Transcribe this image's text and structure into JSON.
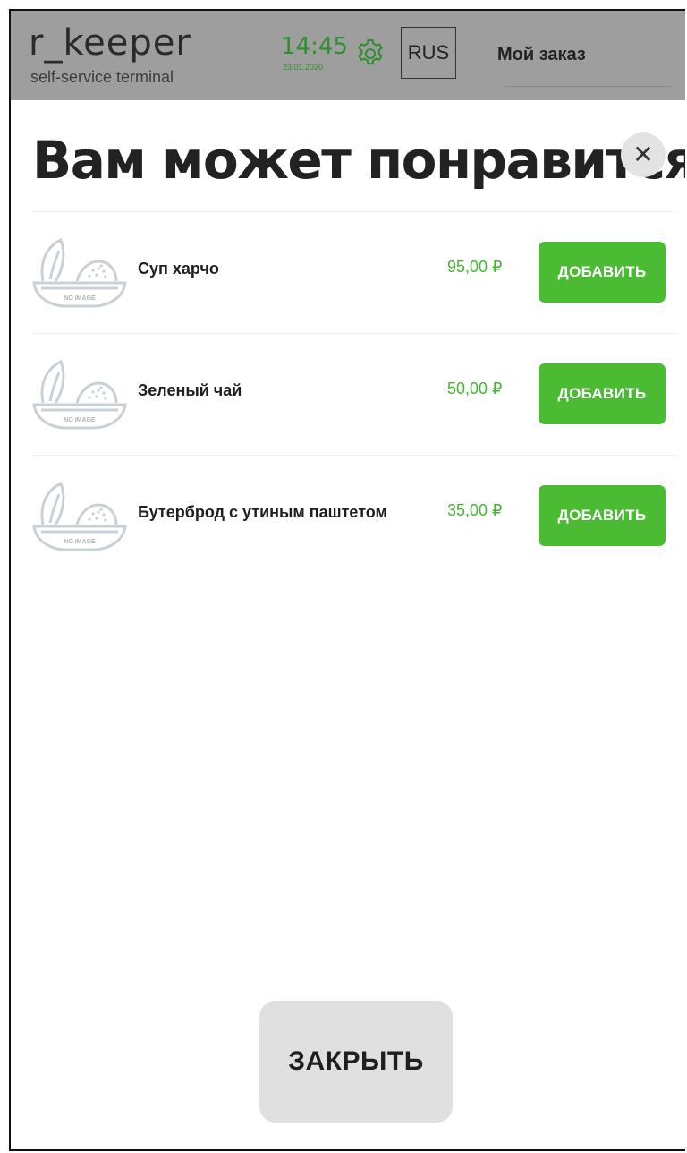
{
  "header": {
    "logo": "r_keeper",
    "logo_sub": "self-service terminal",
    "time": "14:45",
    "date": "23.01.2020",
    "lang": "RUS",
    "my_order": "Мой заказ"
  },
  "modal": {
    "title": "Вам может понравится",
    "close_x": "✕",
    "items": [
      {
        "name": "Суп харчо",
        "price": "95,00 ₽",
        "add_label": "ДОБАВИТЬ",
        "placeholder": "NO IMAGE"
      },
      {
        "name": "Зеленый чай",
        "price": "50,00 ₽",
        "add_label": "ДОБАВИТЬ",
        "placeholder": "NO IMAGE"
      },
      {
        "name": "Бутерброд с утиным паштетом",
        "price": "35,00 ₽",
        "add_label": "ДОБАВИТЬ",
        "placeholder": "NO IMAGE"
      }
    ],
    "close_button": "ЗАКРЫТЬ"
  },
  "colors": {
    "accent_green": "#4cbb34",
    "price_green": "#44b52f",
    "header_bg": "#9e9e9e"
  },
  "icons": [
    "gear-icon",
    "close-icon",
    "no-image-icon"
  ]
}
